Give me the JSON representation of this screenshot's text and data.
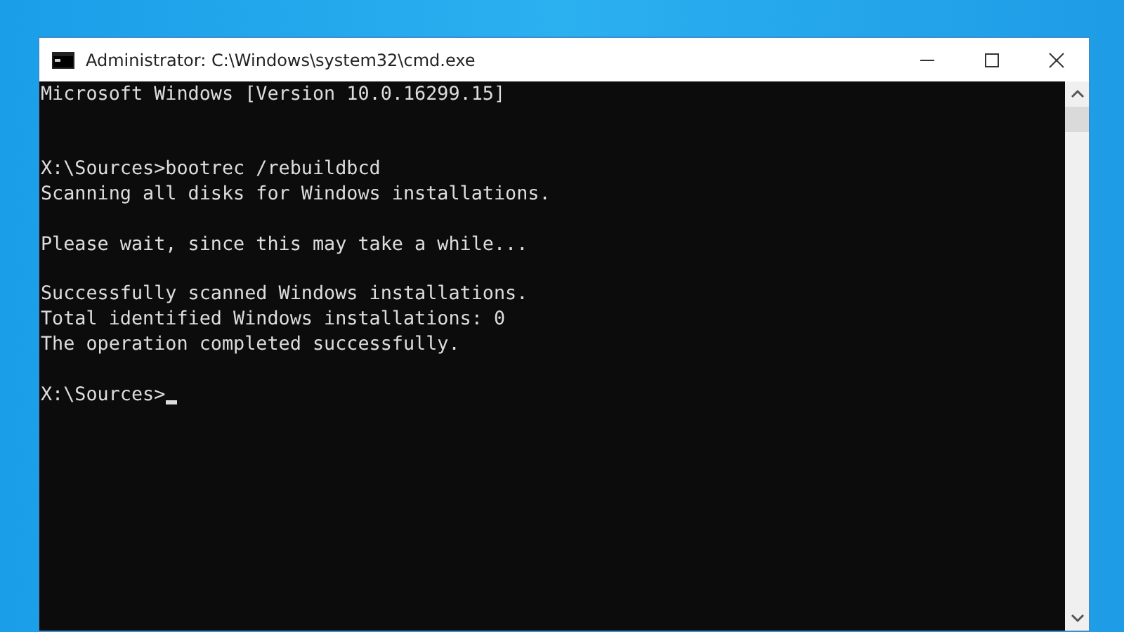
{
  "window": {
    "title": "Administrator: C:\\Windows\\system32\\cmd.exe"
  },
  "console": {
    "lines": [
      {
        "kind": "text",
        "text": "Microsoft Windows [Version 10.0.16299.15]"
      },
      {
        "kind": "blank"
      },
      {
        "kind": "blank"
      },
      {
        "kind": "text",
        "text": "X:\\Sources>bootrec /rebuildbcd"
      },
      {
        "kind": "text",
        "text": "Scanning all disks for Windows installations."
      },
      {
        "kind": "blank"
      },
      {
        "kind": "text",
        "text": "Please wait, since this may take a while..."
      },
      {
        "kind": "blank"
      },
      {
        "kind": "text",
        "text": "Successfully scanned Windows installations."
      },
      {
        "kind": "text",
        "text": "Total identified Windows installations: 0"
      },
      {
        "kind": "text",
        "text": "The operation completed successfully."
      },
      {
        "kind": "blank"
      },
      {
        "kind": "prompt",
        "text": "X:\\Sources>"
      }
    ]
  }
}
